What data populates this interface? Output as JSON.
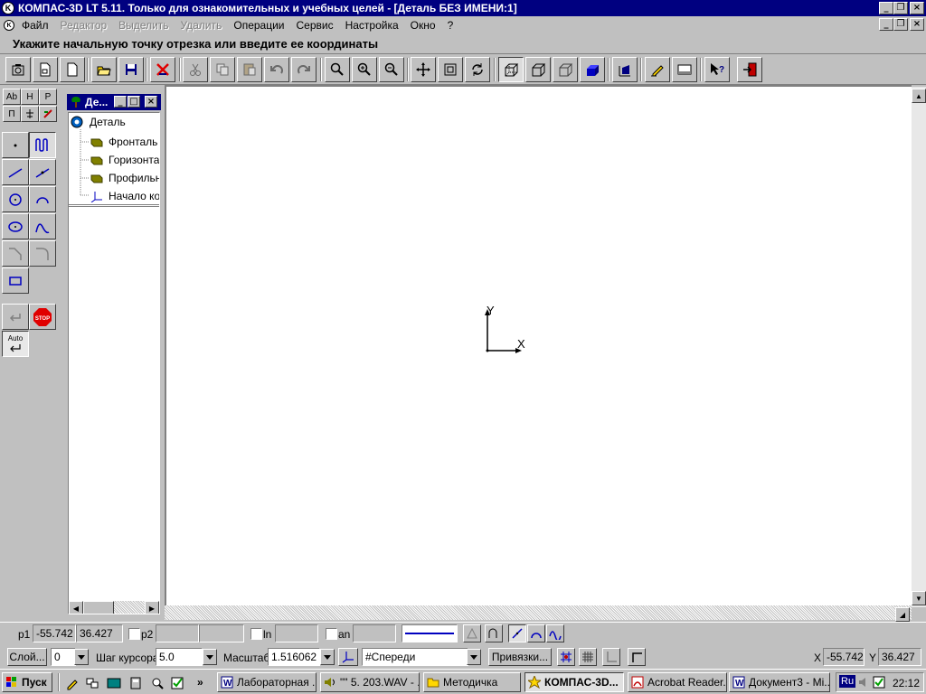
{
  "window": {
    "title": "КОМПАС-3D LT 5.11. Только для ознакомительных и учебных целей - [Деталь БЕЗ ИМЕНИ:1]"
  },
  "menu": [
    {
      "label": "Файл",
      "enabled": true
    },
    {
      "label": "Редактор",
      "enabled": false
    },
    {
      "label": "Выделить",
      "enabled": false
    },
    {
      "label": "Удалить",
      "enabled": false
    },
    {
      "label": "Операции",
      "enabled": true
    },
    {
      "label": "Сервис",
      "enabled": true
    },
    {
      "label": "Настройка",
      "enabled": true
    },
    {
      "label": "Окно",
      "enabled": true
    },
    {
      "label": "?",
      "enabled": true
    }
  ],
  "prompt": "Укажите начальную точку отрезка или введите ее координаты",
  "panel_tabs": [
    "Аb",
    "Н",
    "Р",
    "П"
  ],
  "auto_label": "Auto",
  "tree": {
    "title": "Де...",
    "root": "Деталь",
    "items": [
      "Фронталь",
      "Горизонта",
      "Профильн",
      "Начало ко"
    ]
  },
  "canvas": {
    "axis_y": "Y",
    "axis_x": "X"
  },
  "status": {
    "p1_label": "p1",
    "p1_x": "-55.742",
    "p1_y": "36.427",
    "p2_label": "p2",
    "ln_label": "ln",
    "an_label": "an"
  },
  "status2": {
    "layer_button": "Слой...",
    "layer_value": "0",
    "step_label": "Шаг курсора",
    "step_value": "5.0",
    "scale_label": "Масштаб",
    "scale_value": "1.516062",
    "view_value": "#Спереди",
    "snaps_button": "Привязки...",
    "x_label": "X",
    "x_value": "-55.742",
    "y_label": "Y",
    "y_value": "36.427"
  },
  "taskbar": {
    "start": "Пуск",
    "tasks": [
      {
        "label": "Лабораторная ...",
        "active": false
      },
      {
        "label": "\"\" 5. 203.WAV - ...",
        "active": false
      },
      {
        "label": "Методичка",
        "active": false
      },
      {
        "label": "КОМПАС-3D...",
        "active": true
      },
      {
        "label": "Acrobat Reader...",
        "active": false
      },
      {
        "label": "Документ3 - Mi...",
        "active": false
      }
    ],
    "lang": "Ru",
    "clock": "22:12",
    "more": "»"
  },
  "colors": {
    "title_bg": "#000080",
    "face": "#c0c0c0",
    "accent_blue": "#0000c0"
  }
}
